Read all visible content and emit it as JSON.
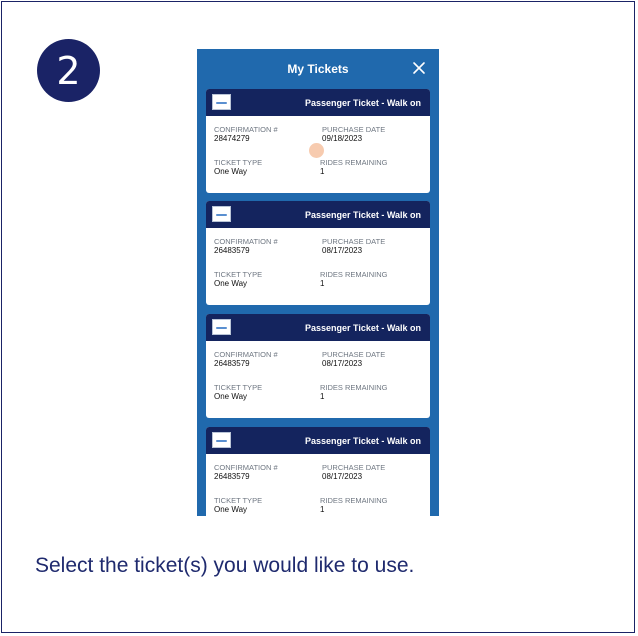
{
  "step_number": "2",
  "header": {
    "title": "My Tickets"
  },
  "labels": {
    "confirmation": "CONFIRMATION #",
    "purchase_date": "PURCHASE DATE",
    "ticket_type": "TICKET TYPE",
    "rides_remaining": "RIDES REMAINING"
  },
  "tickets": [
    {
      "title": "Passenger Ticket - Walk on",
      "confirmation": "28474279",
      "purchase_date": "09/18/2023",
      "ticket_type": "One Way",
      "rides_remaining": "1"
    },
    {
      "title": "Passenger Ticket - Walk on",
      "confirmation": "26483579",
      "purchase_date": "08/17/2023",
      "ticket_type": "One Way",
      "rides_remaining": "1"
    },
    {
      "title": "Passenger Ticket - Walk on",
      "confirmation": "26483579",
      "purchase_date": "08/17/2023",
      "ticket_type": "One Way",
      "rides_remaining": "1"
    },
    {
      "title": "Passenger Ticket - Walk on",
      "confirmation": "26483579",
      "purchase_date": "08/17/2023",
      "ticket_type": "One Way",
      "rides_remaining": "1"
    }
  ],
  "caption": "Select the ticket(s) you would like to use.",
  "colors": {
    "navy": "#1a2366",
    "app_blue": "#2069ad",
    "ticket_header": "#14245e",
    "click_marker": "#f1a06e"
  }
}
